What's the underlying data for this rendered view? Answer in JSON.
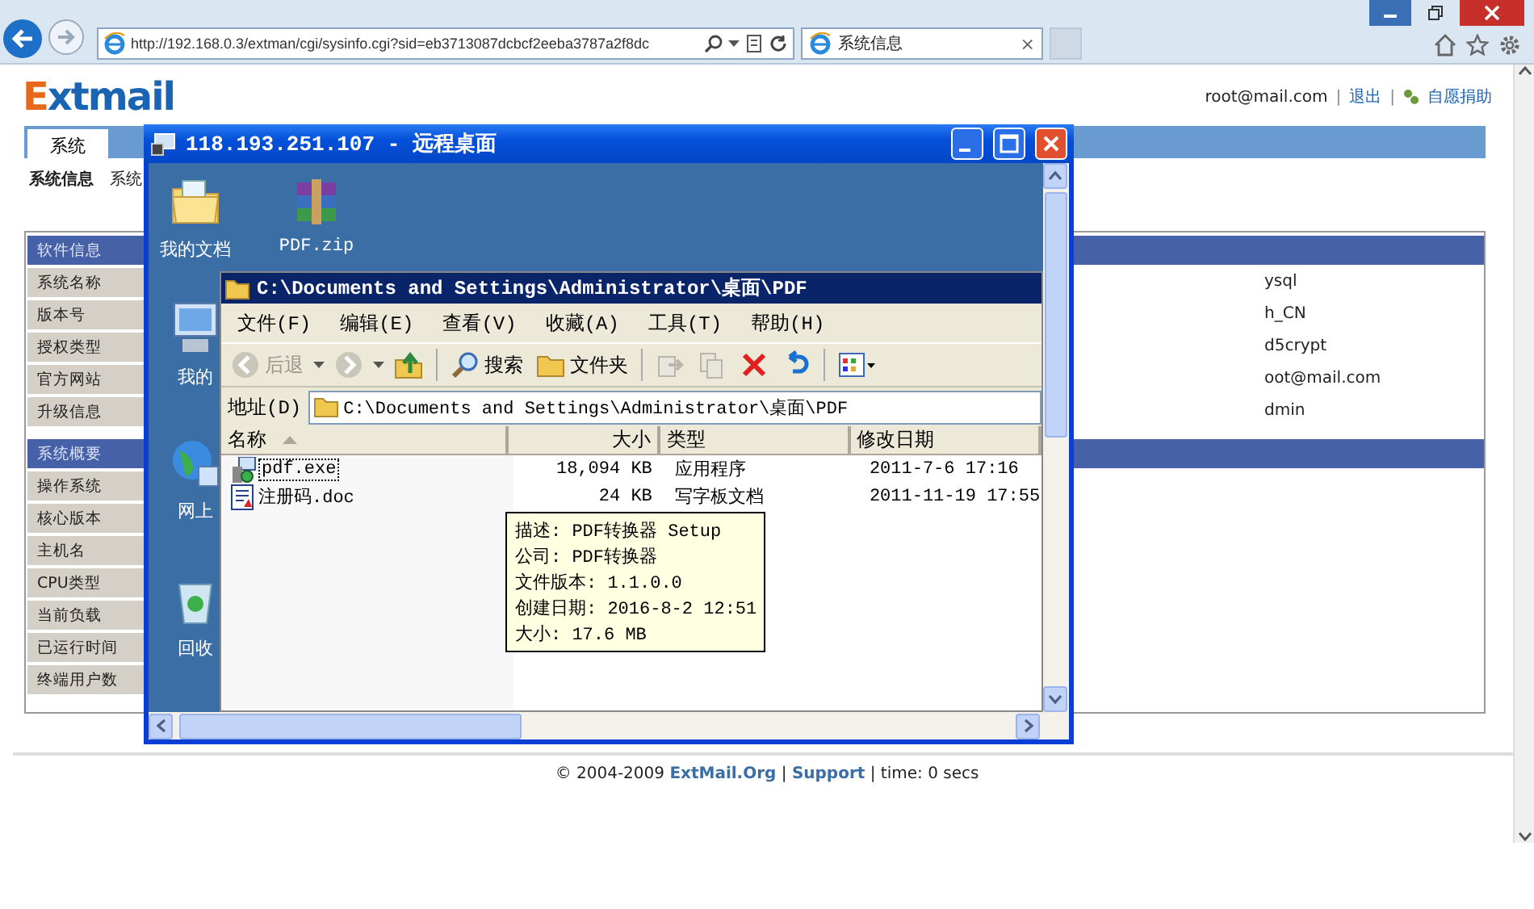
{
  "browser": {
    "url": "http://192.168.0.3/extman/cgi/sysinfo.cgi?sid=eb3713087dcbcf2eeba3787a2f8dc",
    "tabs": [
      {
        "title": "系统信息",
        "selected": true
      }
    ],
    "close_tab": "×"
  },
  "page": {
    "logo": "Extmail",
    "userbar": [
      {
        "kind": "text",
        "text": "root@mail.com"
      },
      {
        "kind": "sep",
        "text": "|"
      },
      {
        "kind": "link",
        "text": "退出"
      },
      {
        "kind": "sep",
        "text": "|"
      },
      {
        "kind": "donate",
        "text": "自愿捐助"
      }
    ],
    "nav_tabs": [
      {
        "label": "系统",
        "selected": true
      }
    ],
    "subnav": [
      {
        "label": "系统信息",
        "selected": true
      },
      {
        "label": "系统",
        "selected": false
      }
    ],
    "sections": [
      {
        "title": "软件信息",
        "rows": [
          {
            "label": "系统名称",
            "value": "ysql"
          },
          {
            "label": "版本号",
            "value": "h_CN"
          },
          {
            "label": "授权类型",
            "value": "d5crypt"
          },
          {
            "label": "官方网站",
            "value": "oot@mail.com"
          },
          {
            "label": "升级信息",
            "value": "dmin"
          }
        ]
      },
      {
        "title": "系统概要",
        "rows": [
          {
            "label": "操作系统"
          },
          {
            "label": "核心版本"
          },
          {
            "label": "主机名"
          },
          {
            "label": "CPU类型"
          },
          {
            "label": "当前负载"
          },
          {
            "label": "已运行时间"
          },
          {
            "label": "终端用户数"
          }
        ]
      }
    ],
    "footer": [
      {
        "kind": "text",
        "text": "© 2004-2009"
      },
      {
        "kind": "link",
        "text": "ExtMail.Org"
      },
      {
        "kind": "text",
        "text": "|"
      },
      {
        "kind": "link",
        "text": "Support"
      },
      {
        "kind": "text",
        "text": "| time: 0 secs"
      }
    ]
  },
  "remote": {
    "title": "118.193.251.107 - 远程桌面",
    "desktop_icons": [
      {
        "label": "我的文档",
        "kind": "documents"
      },
      {
        "label": "PDF.zip",
        "kind": "archive"
      },
      {
        "label": "我的",
        "kind": "computer"
      },
      {
        "label": "网上",
        "kind": "network"
      },
      {
        "label": "回收",
        "kind": "recycle"
      }
    ],
    "explorer": {
      "title": "C:\\Documents and Settings\\Administrator\\桌面\\PDF",
      "menu": [
        "文件(F)",
        "编辑(E)",
        "查看(V)",
        "收藏(A)",
        "工具(T)",
        "帮助(H)"
      ],
      "toolbar": [
        {
          "kind": "back",
          "label": "后退",
          "disabled": true
        },
        {
          "kind": "forward",
          "disabled": true
        },
        {
          "kind": "up",
          "disabled": false
        },
        {
          "kind": "search",
          "label": "搜索",
          "disabled": false
        },
        {
          "kind": "folders",
          "label": "文件夹",
          "disabled": false
        },
        {
          "kind": "move",
          "disabled": true
        },
        {
          "kind": "copy",
          "disabled": true
        },
        {
          "kind": "delete",
          "disabled": false
        },
        {
          "kind": "undo",
          "disabled": false
        },
        {
          "kind": "views",
          "disabled": false
        }
      ],
      "address_label": "地址(D)",
      "address": "C:\\Documents and Settings\\Administrator\\桌面\\PDF",
      "columns": [
        {
          "label": "名称",
          "sorted": true
        },
        {
          "label": "大小",
          "sorted": false
        },
        {
          "label": "类型",
          "sorted": false
        },
        {
          "label": "修改日期",
          "sorted": false
        }
      ],
      "rows": [
        {
          "name": "pdf.exe",
          "kind": "exe",
          "size": "18,094 KB",
          "type": "应用程序",
          "modified": "2011-7-6 17:16",
          "focused": true
        },
        {
          "name": "注册码.doc",
          "kind": "doc",
          "size": "24 KB",
          "type": "写字板文档",
          "modified": "2011-11-19 17:55",
          "focused": false
        }
      ],
      "tooltip": [
        "描述: PDF转换器 Setup",
        "公司: PDF转换器",
        "文件版本: 1.1.0.0",
        "创建日期: 2016-8-2 12:51",
        "大小: 17.6 MB"
      ]
    }
  }
}
